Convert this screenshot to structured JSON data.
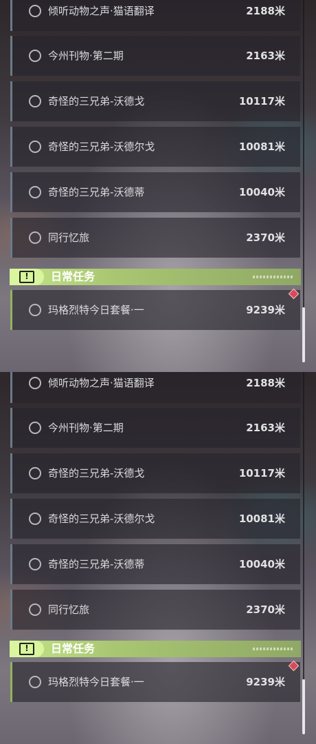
{
  "tasks": [
    {
      "name": "倾听动物之声·猫语翻译",
      "distance": "2188米"
    },
    {
      "name": "今州刊物·第二期",
      "distance": "2163米"
    },
    {
      "name": "奇怪的三兄弟-沃德戈",
      "distance": "10117米"
    },
    {
      "name": "奇怪的三兄弟-沃德尔戈",
      "distance": "10081米"
    },
    {
      "name": "奇怪的三兄弟-沃德蒂",
      "distance": "10040米"
    },
    {
      "name": "同行忆旅",
      "distance": "2370米"
    }
  ],
  "daily_section": {
    "title": "日常任务",
    "icon": "alert-icon",
    "tasks": [
      {
        "name": "玛格烈特今日套餐·一",
        "distance": "9239米",
        "marker": "tracked-diamond-icon"
      }
    ]
  },
  "colors": {
    "section_accent": "#a9c772",
    "marker": "#d84a55",
    "quest_bar": "#6c7a88"
  }
}
